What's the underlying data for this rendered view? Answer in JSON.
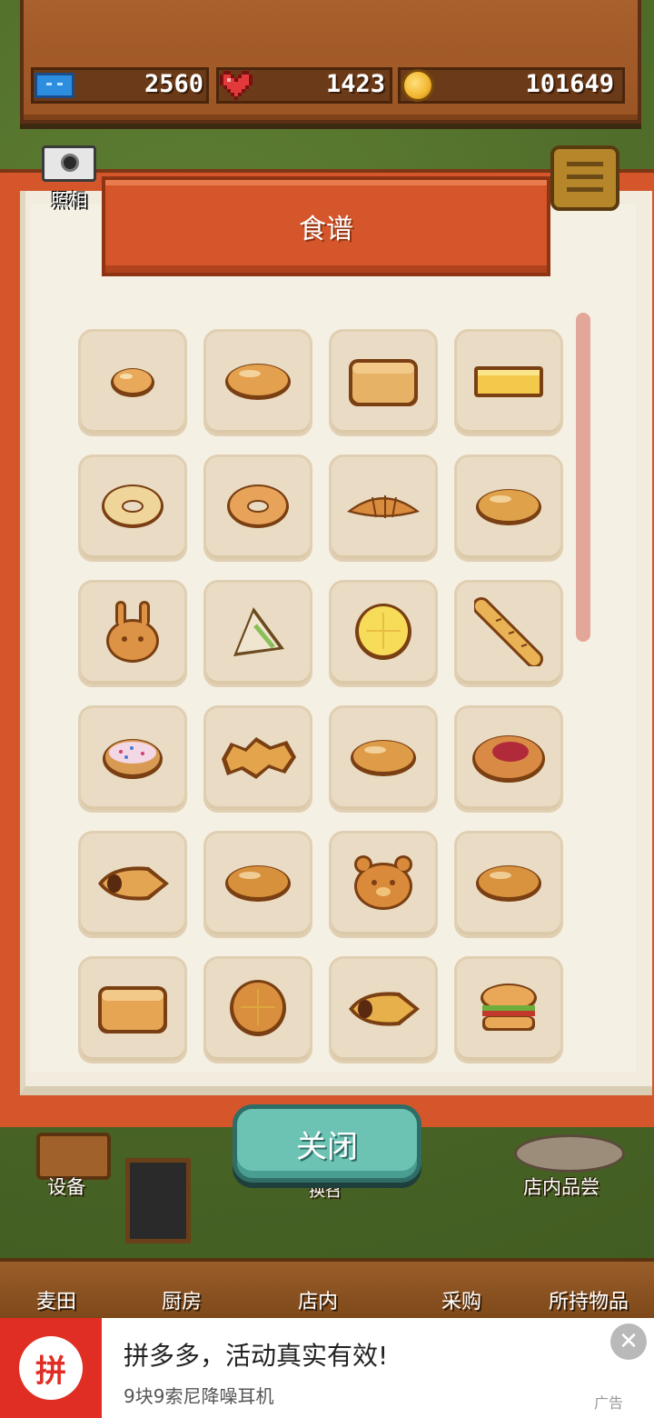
{
  "resources": {
    "tickets": "2560",
    "hearts": "1423",
    "coins": "101649"
  },
  "photo_label": "照相",
  "ribbon_title": "食谱",
  "close_label": "关闭",
  "scene_labels": {
    "equipment": "设备",
    "tasting": "店内品尝",
    "partial": "换召"
  },
  "nav": [
    {
      "label": "麦田",
      "icon": "wheat-field-icon"
    },
    {
      "label": "厨房",
      "icon": "kitchen-icon"
    },
    {
      "label": "店内",
      "icon": "bread-basket-icon"
    },
    {
      "label": "采购",
      "icon": "shop-icon"
    },
    {
      "label": "所持物品",
      "icon": "box-icon"
    }
  ],
  "recipes": [
    {
      "name": "small-roll",
      "color": "#e8a95a",
      "shape": "roll"
    },
    {
      "name": "butter-roll",
      "color": "#e3a04e",
      "shape": "oval"
    },
    {
      "name": "loaf-bread",
      "color": "#e6b266",
      "shape": "loaf"
    },
    {
      "name": "sponge-cake",
      "color": "#f2c94a",
      "shape": "bar"
    },
    {
      "name": "bagel-plain",
      "color": "#f0d59a",
      "shape": "ring"
    },
    {
      "name": "bagel",
      "color": "#e8a35a",
      "shape": "ring"
    },
    {
      "name": "croissant",
      "color": "#d98b3e",
      "shape": "croissant"
    },
    {
      "name": "melon-pastry",
      "color": "#dfa14a",
      "shape": "oval"
    },
    {
      "name": "bunny-bread",
      "color": "#dd9345",
      "shape": "bunny"
    },
    {
      "name": "sandwich",
      "color": "#f0e6cf",
      "shape": "triangle"
    },
    {
      "name": "melon-bun",
      "color": "#f7dc5a",
      "shape": "round"
    },
    {
      "name": "baguette",
      "color": "#e8b255",
      "shape": "stick"
    },
    {
      "name": "sprinkle-donut",
      "color": "#d99a54",
      "shape": "donut"
    },
    {
      "name": "cornflake-bread",
      "color": "#e4a44c",
      "shape": "flake"
    },
    {
      "name": "bread-bun",
      "color": "#df9c48",
      "shape": "oval"
    },
    {
      "name": "jam-danish",
      "color": "#d98a44",
      "shape": "jam"
    },
    {
      "name": "chocolate-cornet",
      "color": "#e3a552",
      "shape": "cornet"
    },
    {
      "name": "herb-bread",
      "color": "#d7903c",
      "shape": "oval"
    },
    {
      "name": "bear-bread",
      "color": "#d98a3a",
      "shape": "bear"
    },
    {
      "name": "chocolate-bread",
      "color": "#d9923e",
      "shape": "oval"
    },
    {
      "name": "fruit-toast",
      "color": "#e5a552",
      "shape": "loaf"
    },
    {
      "name": "cinnamon-roll",
      "color": "#d98f3e",
      "shape": "round"
    },
    {
      "name": "cream-bun",
      "color": "#e8b04a",
      "shape": "cornet"
    },
    {
      "name": "burger",
      "color": "#e8a857",
      "shape": "burger"
    }
  ],
  "ad": {
    "title": "拼多多，活动真实有效!",
    "subtitle": "9块9索尼降噪耳机",
    "tag": "广告",
    "logo_text": "拼"
  }
}
